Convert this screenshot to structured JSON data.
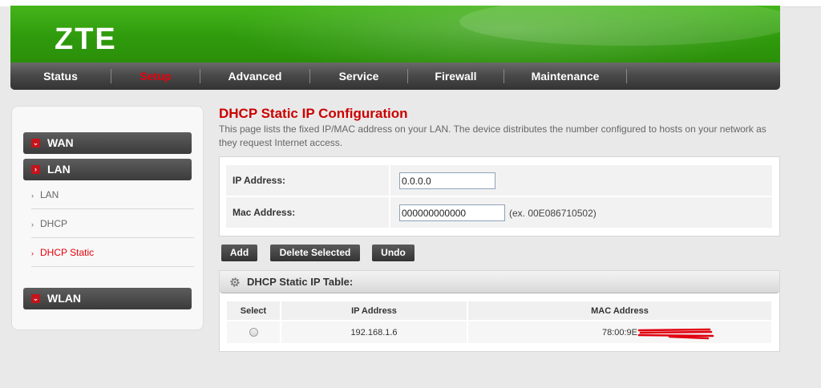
{
  "brand": {
    "logo_text": "ZTE",
    "accent": "#e8000b",
    "banner_green": "#3aa812"
  },
  "nav": {
    "items": [
      {
        "label": "Status",
        "active": false
      },
      {
        "label": "Setup",
        "active": true
      },
      {
        "label": "Advanced",
        "active": false
      },
      {
        "label": "Service",
        "active": false
      },
      {
        "label": "Firewall",
        "active": false
      },
      {
        "label": "Maintenance",
        "active": false
      }
    ]
  },
  "sidebar": {
    "groups": [
      {
        "label": "WAN",
        "icon": "chevron-down-icon"
      },
      {
        "label": "LAN",
        "icon": "chevron-right-icon"
      },
      {
        "label": "WLAN",
        "icon": "chevron-down-icon"
      }
    ],
    "sub_items": [
      {
        "label": "LAN",
        "active": false
      },
      {
        "label": "DHCP",
        "active": false
      },
      {
        "label": "DHCP Static",
        "active": true
      }
    ]
  },
  "main": {
    "title": "DHCP Static IP Configuration",
    "description": "This page lists the fixed IP/MAC address on your LAN. The device distributes the number configured to hosts on your network as they request Internet access.",
    "form": {
      "ip_label": "IP Address:",
      "ip_value": "0.0.0.0",
      "mac_label": "Mac Address:",
      "mac_value": "000000000000",
      "mac_hint": "(ex. 00E086710502)"
    },
    "buttons": {
      "add": "Add",
      "delete": "Delete Selected",
      "undo": "Undo"
    },
    "table": {
      "title": "DHCP Static IP Table:",
      "columns": [
        "Select",
        "IP Address",
        "MAC Address"
      ],
      "rows": [
        {
          "ip": "192.168.1.6",
          "mac": "78:00:9E"
        }
      ]
    }
  }
}
